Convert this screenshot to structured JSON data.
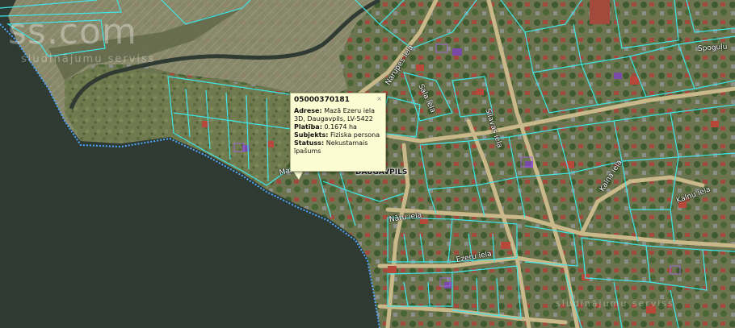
{
  "popup": {
    "title": "05000370181",
    "close_symbol": "×",
    "address_label": "Adrese:",
    "address_value": "Mazā Ezeru iela 3D, Daugavpils, LV-5422",
    "area_label": "Platība:",
    "area_value": "0.1674 ha",
    "subject_label": "Subjekts:",
    "subject_value": "Fiziska persona",
    "status_label": "Statuss:",
    "status_value": "Nekustamais īpašums"
  },
  "labels": {
    "city": "DAUGAVPILS",
    "watermark_main": "ss.com",
    "watermark_sub": "sludinājumu serviss",
    "watermark_corner": "sludinājumu serviss"
  },
  "streets": [
    {
      "id": "maza-ezeru",
      "text": "Mazā Ezeru iela"
    },
    {
      "id": "narupes",
      "text": "Narupes iela"
    },
    {
      "id": "naru-iela",
      "text": "Nāru iela"
    },
    {
      "id": "ezeru-iela",
      "text": "Ezeru iela"
    },
    {
      "id": "silavas",
      "text": "Silavas iela"
    },
    {
      "id": "sala-iela",
      "text": "Sala iela"
    },
    {
      "id": "kalna-iela",
      "text": "Kalna iela"
    },
    {
      "id": "spodu",
      "text": "Spoguļu"
    },
    {
      "id": "kalnu2",
      "text": "Kalnu iela"
    }
  ],
  "colors": {
    "water": "#2f3a33",
    "parcel_line": "#3fe6ea",
    "boundary": "#4fa8ff",
    "road": "#c9b88a",
    "roof_red": "#b8493a",
    "roof_purple": "#7a4aa8",
    "popup_bg": "#fcfcd2"
  }
}
